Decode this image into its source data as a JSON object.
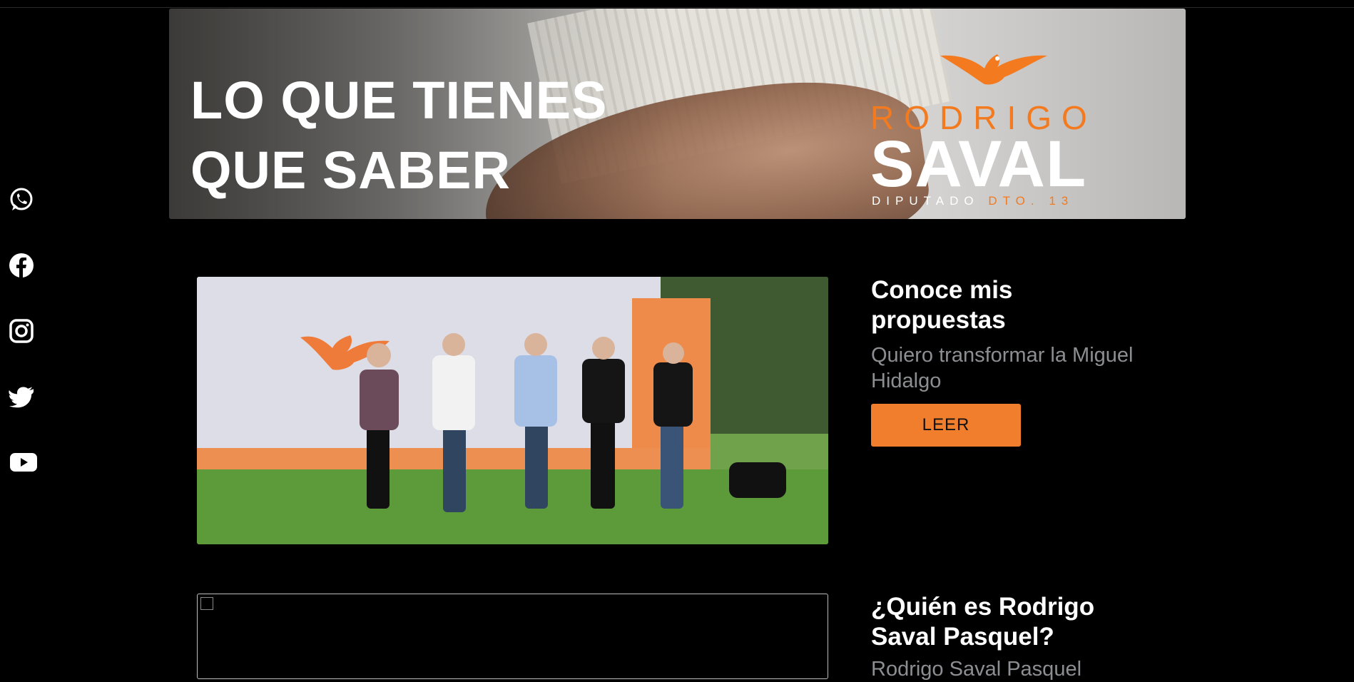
{
  "banner": {
    "title_line1": "LO QUE TIENES",
    "title_line2": "QUE SABER",
    "logo": {
      "name": "RODRIGO",
      "surname": "SAVAL",
      "sub_prefix": "DIPUTADO ",
      "sub_district": "DTO. 13",
      "brand_color": "#f37a1f"
    }
  },
  "social": [
    {
      "name": "whatsapp-icon"
    },
    {
      "name": "facebook-icon"
    },
    {
      "name": "instagram-icon"
    },
    {
      "name": "twitter-icon"
    },
    {
      "name": "youtube-icon"
    }
  ],
  "cards": [
    {
      "title": "Conoce mis propuestas",
      "description": "Quiero transformar la Miguel Hidalgo",
      "button_label": "LEER"
    },
    {
      "title": "¿Quién es Rodrigo Saval Pasquel?",
      "description": "Rodrigo Saval Pasquel"
    }
  ],
  "colors": {
    "background": "#000000",
    "accent": "#f07e2d",
    "muted_text": "#8c8e92"
  }
}
